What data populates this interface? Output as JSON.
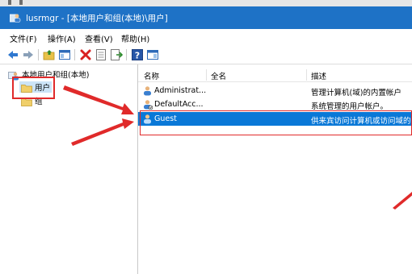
{
  "window": {
    "title": "lusrmgr - [本地用户和组(本地)\\用户]"
  },
  "menu": [
    {
      "label": "文件(F)"
    },
    {
      "label": "操作(A)"
    },
    {
      "label": "查看(V)"
    },
    {
      "label": "帮助(H)"
    }
  ],
  "toolbar": {
    "icons": [
      "back-arrow-icon",
      "forward-arrow-icon",
      "folder-up-icon",
      "show-hide-tree-icon",
      "delete-icon",
      "properties-icon",
      "export-list-icon",
      "help-icon",
      "show-action-pane-icon"
    ]
  },
  "tree": {
    "root_label": "本地用户和组(本地)",
    "items": [
      {
        "label": "用户"
      },
      {
        "label": "组"
      }
    ]
  },
  "list": {
    "columns": [
      "名称",
      "全名",
      "描述"
    ],
    "rows": [
      {
        "name": "Administrat...",
        "fullname": "",
        "description": "管理计算机(域)的内置帐户"
      },
      {
        "name": "DefaultAcc...",
        "fullname": "",
        "description": "系统管理的用户帐户。"
      },
      {
        "name": "Guest",
        "fullname": "",
        "description": "供来宾访问计算机或访问域的"
      }
    ]
  },
  "colors": {
    "titlebar": "#1e72c6",
    "selection": "#0a78d7",
    "highlight": "#e02a2a"
  }
}
